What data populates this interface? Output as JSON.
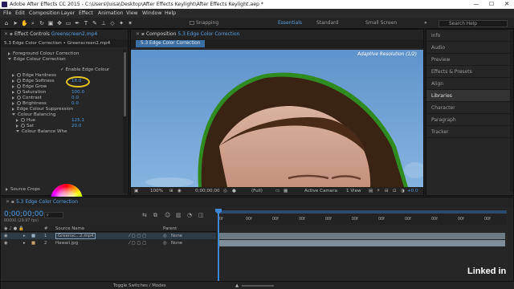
{
  "window": {
    "title": "Adobe After Effects CC 2015 - C:\\Users\\luisa\\Desktop\\After Effects Keylight\\After Effects Keylight.aep *",
    "minimize_glyph": "—",
    "maximize_glyph": "☐",
    "close_glyph": "✕"
  },
  "menu": [
    "File",
    "Edit",
    "Composition",
    "Layer",
    "Effect",
    "Animation",
    "View",
    "Window",
    "Help"
  ],
  "toolbar": {
    "snapping_label": "Snapping",
    "workspaces": [
      "Essentials",
      "Standard",
      "Small Screen"
    ],
    "overflow": "»",
    "search_placeholder": "Search Help"
  },
  "effect_controls": {
    "tab_prefix": "Effect Controls",
    "tab_layer": "Greenscreen2.mp4",
    "breadcrumb": "5.3 Edge Color Correction • Greenscreen2.mp4",
    "rows": [
      {
        "label": "Foreground Colour Correction",
        "indent": 1,
        "kind": "group"
      },
      {
        "label": "Edge Colour Correction",
        "indent": 1,
        "kind": "group-open"
      },
      {
        "label": "",
        "indent": 2,
        "kind": "check",
        "check_label": "Enable Edge Colour"
      },
      {
        "label": "Edge Hardness",
        "indent": 2,
        "kind": "prop",
        "value": ""
      },
      {
        "label": "Edge Softness",
        "indent": 2,
        "kind": "prop",
        "value": "18.0"
      },
      {
        "label": "Edge Grow",
        "indent": 2,
        "kind": "prop",
        "value": ""
      },
      {
        "label": "Saturation",
        "indent": 2,
        "kind": "prop",
        "value": "100.0"
      },
      {
        "label": "Contrast",
        "indent": 2,
        "kind": "prop",
        "value": "0.0"
      },
      {
        "label": "Brightness",
        "indent": 2,
        "kind": "prop",
        "value": "0.0"
      },
      {
        "label": "Edge Colour Suppression",
        "indent": 2,
        "kind": "group"
      },
      {
        "label": "Colour Balancing",
        "indent": 2,
        "kind": "group-open"
      },
      {
        "label": "Hue",
        "indent": 3,
        "kind": "prop",
        "value": "125.1"
      },
      {
        "label": "Sat",
        "indent": 3,
        "kind": "prop",
        "value": "20.0"
      },
      {
        "label": "Colour Balance Whe",
        "indent": 3,
        "kind": "group-open"
      }
    ],
    "source_crops": "Source Crops"
  },
  "composition": {
    "tab_prefix": "Composition",
    "tab_name": "5.3 Edge Color Correction",
    "subtab": "5.3 Edge Color Correction",
    "resolution_overlay": "Adaptive Resolution (1/2)",
    "footer": {
      "zoom": "100%",
      "timecode": "0;00;00;00",
      "resolution": "(Full)",
      "camera": "Active Camera",
      "views": "1 View",
      "offset": "+0.0"
    }
  },
  "right_panel": {
    "items": [
      "Info",
      "Audio",
      "Preview",
      "Effects & Presets",
      "Align",
      "Libraries",
      "Character",
      "Paragraph",
      "Tracker"
    ],
    "selected": "Libraries"
  },
  "timeline": {
    "tab": "5.3 Edge Color Correction",
    "timecode": "0;00;00;00",
    "frame_info": "00000 (29.97 fps)",
    "headers": {
      "num": "#",
      "source": "Source Name",
      "parent": "Parent"
    },
    "layers": [
      {
        "num": "1",
        "name": "Greensc...2.mp4",
        "parent": "None"
      },
      {
        "num": "2",
        "name": "Hawaii.jpg",
        "parent": "None"
      }
    ],
    "ruler": [
      "0f",
      "00f",
      "00f",
      "00f",
      "00f",
      "00f",
      "00f",
      "00f",
      "00f",
      "00f",
      "00f"
    ],
    "toggle_label": "Toggle Switches / Modes"
  },
  "watermark": "Linked in"
}
